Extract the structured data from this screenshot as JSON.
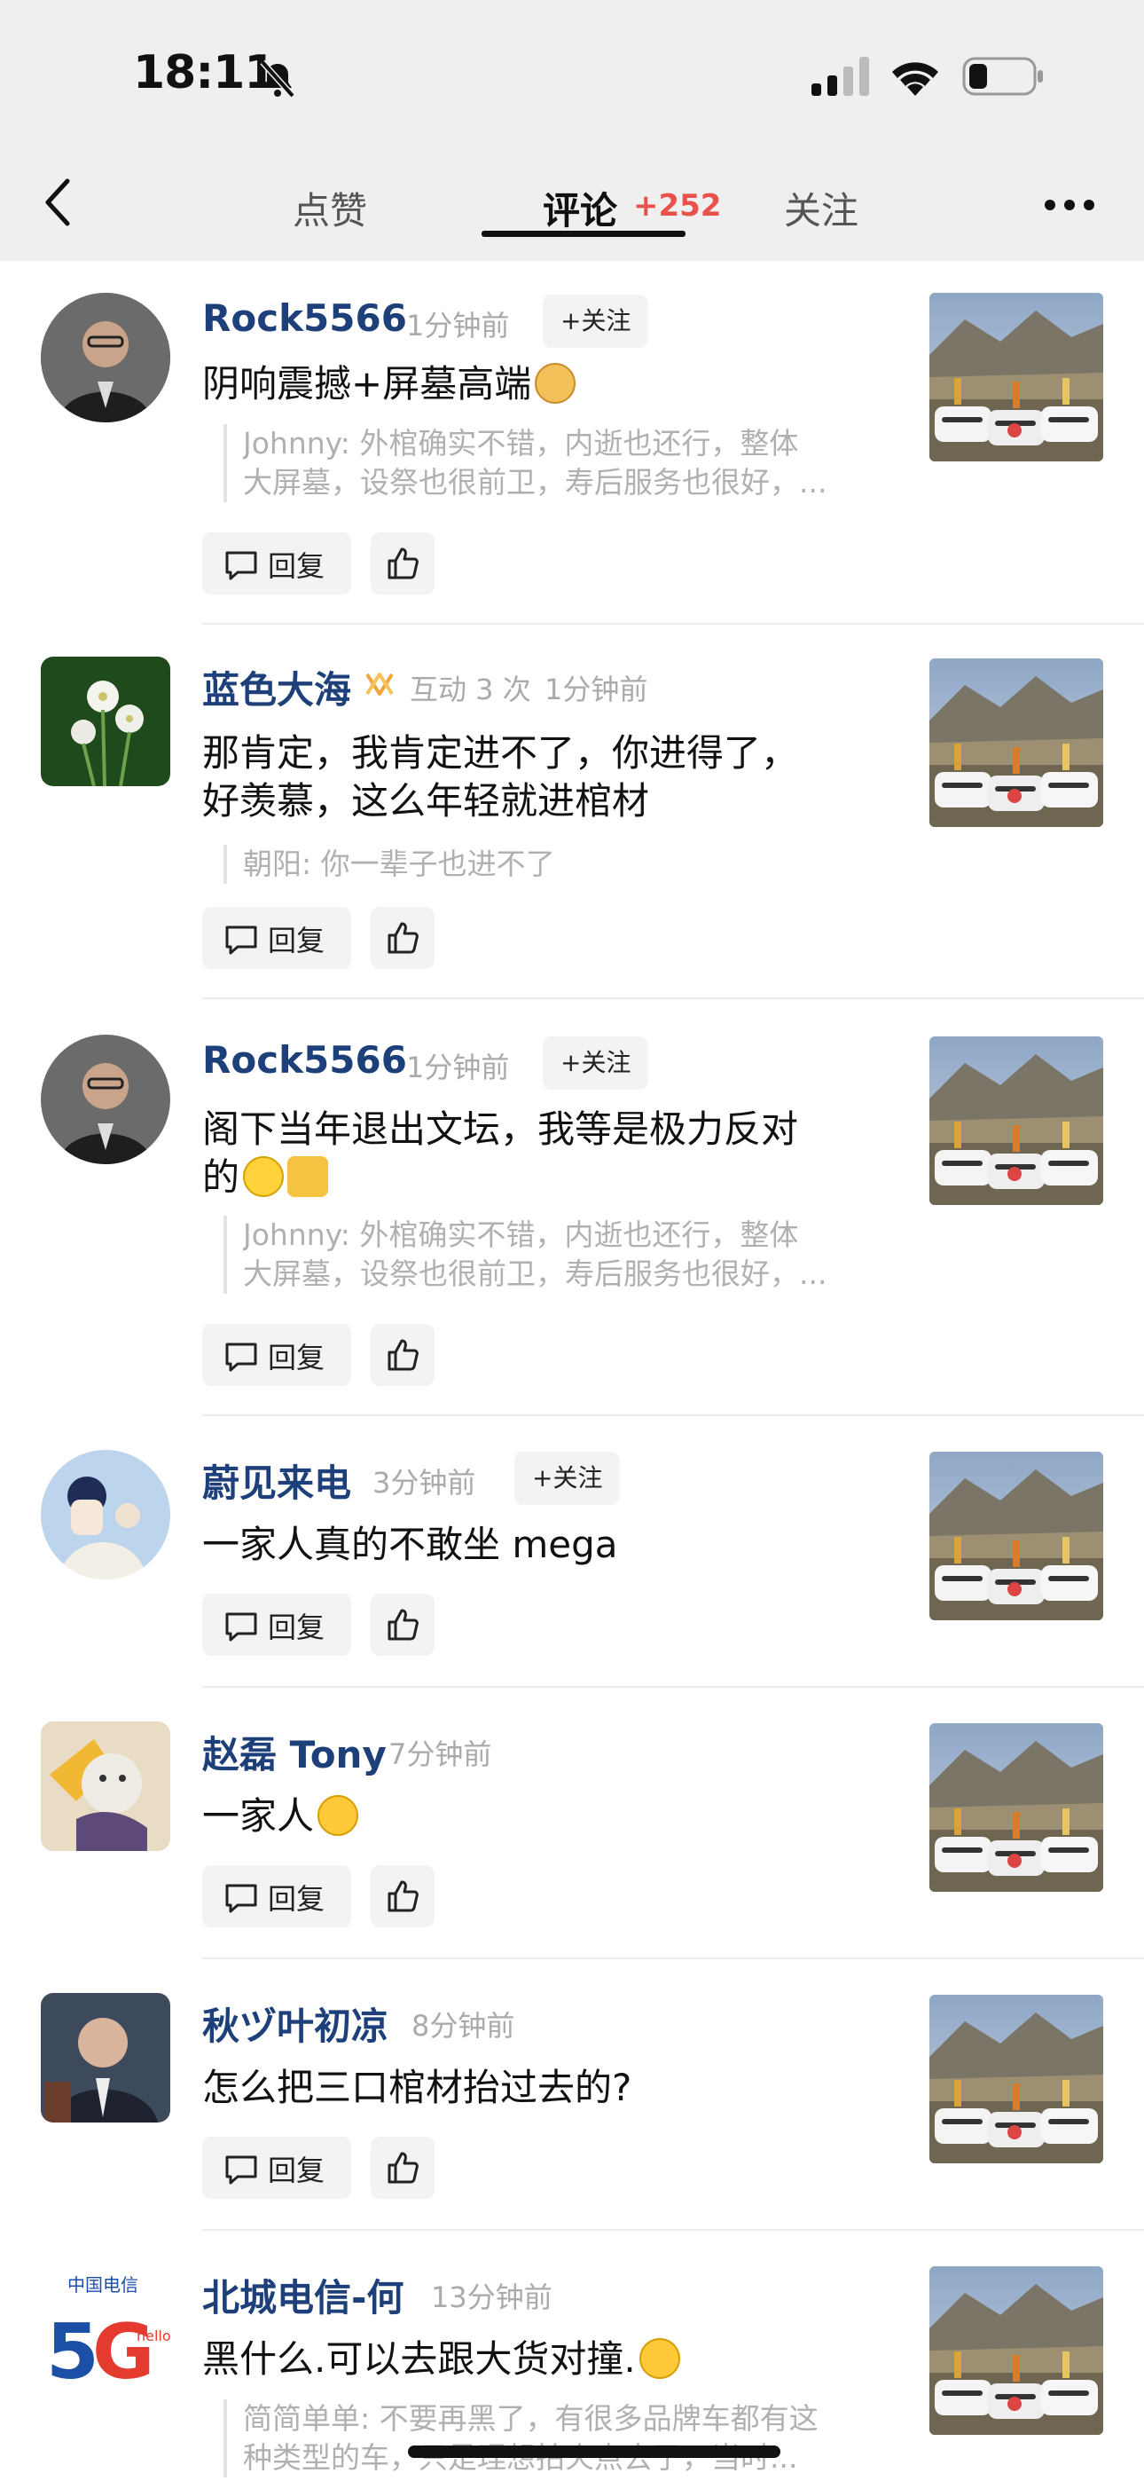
{
  "status": {
    "time": "18:11"
  },
  "nav": {
    "tab_likes": "点赞",
    "tab_comments": "评论",
    "comment_count": "+252",
    "tab_follow": "关注",
    "accent_color": "#e8524a"
  },
  "labels": {
    "reply": "回复",
    "follow": "+关注"
  },
  "comments": [
    {
      "user": "Rock5566",
      "time": "1分钟前",
      "interaction": "",
      "text": "阴响震撼+屏墓高端",
      "quote1": "Johnny: 外棺确实不错，内逝也还行，整体",
      "quote2": "大屏墓，设祭也很前卫，寿后服务也很好，..."
    },
    {
      "user": "蓝色大海",
      "time": "1分钟前",
      "interaction": "互动 3 次",
      "text1": "那肯定，我肯定进不了，你进得了，",
      "text2": "好羡慕，这么年轻就进棺材",
      "quote1": "朝阳: 你一辈子也进不了"
    },
    {
      "user": "Rock5566",
      "time": "1分钟前",
      "text1": "阁下当年退出文坛，我等是极力反对",
      "text2": "的",
      "quote1": "Johnny: 外棺确实不错，内逝也还行，整体",
      "quote2": "大屏墓，设祭也很前卫，寿后服务也很好，..."
    },
    {
      "user": "蔚见来电",
      "time": "3分钟前",
      "text": "一家人真的不敢坐 mega"
    },
    {
      "user": "赵磊 Tony",
      "time": "7分钟前",
      "text": "一家人"
    },
    {
      "user": "秋ヅ叶初凉",
      "time": "8分钟前",
      "text": "怎么把三口棺材抬过去的?"
    },
    {
      "user": "北城电信-何",
      "time": "13分钟前",
      "text": "黑什么.可以去跟大货对撞.",
      "quote1": "简简单单: 不要再黑了，有很多品牌车都有这",
      "quote2": "种类型的车，只是理想拍火点去了，当时..."
    }
  ]
}
